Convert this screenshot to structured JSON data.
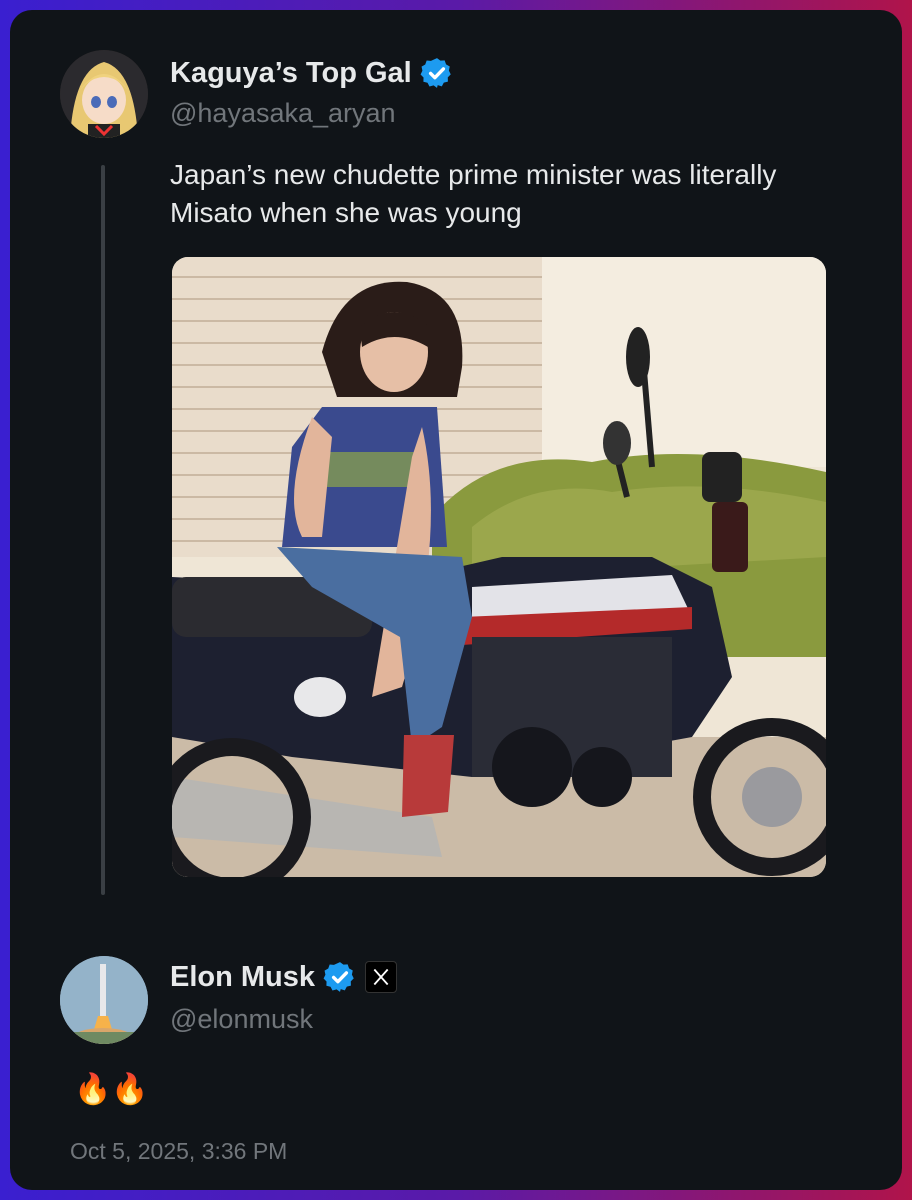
{
  "quoted_post": {
    "display_name": "Kaguya’s Top Gal",
    "handle": "@hayasaka_aryan",
    "text": "Japan’s new chudette prime minister was literally\nMisato when she was young"
  },
  "reply_post": {
    "display_name": "Elon Musk",
    "handle": "@elonmusk",
    "text": "🔥🔥",
    "timestamp": "Oct 5, 2025, 3:36 PM"
  },
  "colors": {
    "verified_blue": "#1d9bf0",
    "card_bg": "#101418",
    "text_primary": "#e7e9ea",
    "text_secondary": "#71767b"
  },
  "icons": {
    "verified": "verified-badge-icon",
    "x_logo": "x-logo-icon"
  }
}
